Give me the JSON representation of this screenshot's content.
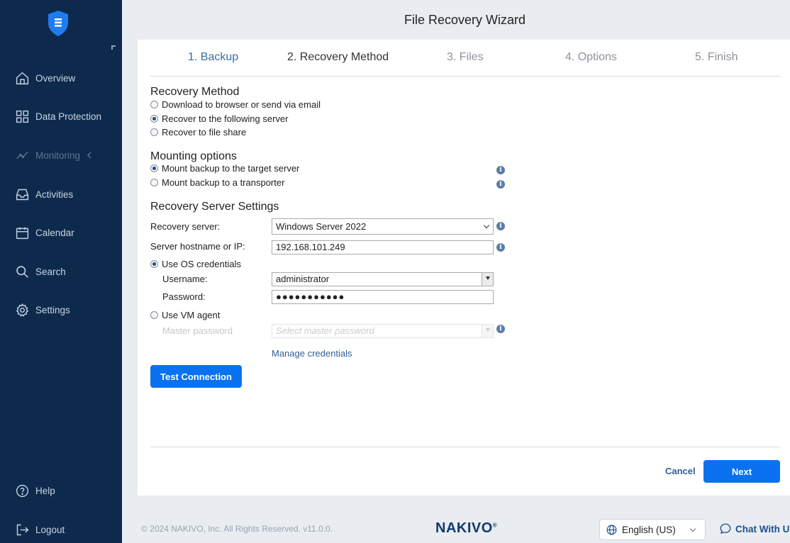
{
  "sidebar": {
    "items": [
      {
        "label": "Overview",
        "icon": "home-icon"
      },
      {
        "label": "Data Protection",
        "icon": "grid-icon"
      },
      {
        "label": "Monitoring",
        "icon": "chart-line-icon"
      },
      {
        "label": "Activities",
        "icon": "inbox-icon"
      },
      {
        "label": "Calendar",
        "icon": "calendar-icon"
      },
      {
        "label": "Search",
        "icon": "search-icon"
      },
      {
        "label": "Settings",
        "icon": "gear-icon"
      }
    ],
    "help": "Help",
    "logout": "Logout"
  },
  "wizard": {
    "title": "File Recovery Wizard",
    "steps": [
      "1. Backup",
      "2. Recovery Method",
      "3. Files",
      "4. Options",
      "5. Finish"
    ],
    "active_step": 2
  },
  "recovery_method": {
    "title": "Recovery Method",
    "options": [
      "Download to browser or send via email",
      "Recover to the following server",
      "Recover to file share"
    ],
    "selected": 1
  },
  "mounting": {
    "title": "Mounting options",
    "options": [
      "Mount backup to the target server",
      "Mount backup to a transporter"
    ],
    "selected": 0
  },
  "server_settings": {
    "title": "Recovery Server Settings",
    "recovery_server_label": "Recovery server:",
    "recovery_server_value": "Windows Server 2022",
    "hostname_label": "Server hostname or IP:",
    "hostname_value": "192.168.101.249",
    "os_credentials_label": "Use OS credentials",
    "username_label": "Username:",
    "username_value": "administrator",
    "password_label": "Password:",
    "password_value": "●●●●●●●●●●●",
    "vm_agent_label": "Use VM agent",
    "master_password_label": "Master password",
    "master_password_placeholder": "Select master password",
    "manage_credentials": "Manage credentials",
    "test_connection": "Test Connection"
  },
  "footer": {
    "cancel": "Cancel",
    "next": "Next",
    "copyright": "© 2024 NAKIVO, Inc. All Rights Reserved. v11.0.0.",
    "brand": "NAKIVO",
    "brand_mark": "®",
    "language": "English (US)",
    "chat": "Chat With Us"
  },
  "colors": {
    "sidebar_bg": "#0d2a4d",
    "accent": "#0a72f0",
    "link": "#2f5f96"
  }
}
